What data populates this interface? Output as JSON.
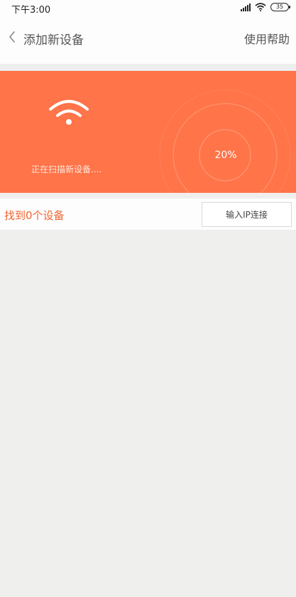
{
  "status_bar": {
    "time": "下午3:00",
    "battery_level": "35",
    "signal_icon": "signal-icon",
    "wifi_icon": "wifi-icon"
  },
  "header": {
    "back_icon": "chevron-left-icon",
    "title": "添加新设备",
    "help_label": "使用帮助"
  },
  "scan_panel": {
    "icon": "wifi-icon",
    "status_text": "正在扫描新设备....",
    "progress_label": "20%",
    "progress_percent": 20,
    "background_color": "#ff7449"
  },
  "results": {
    "found_text": "找到0个设备",
    "ip_button_label": "输入IP连接",
    "accent_color": "#f2652f"
  }
}
